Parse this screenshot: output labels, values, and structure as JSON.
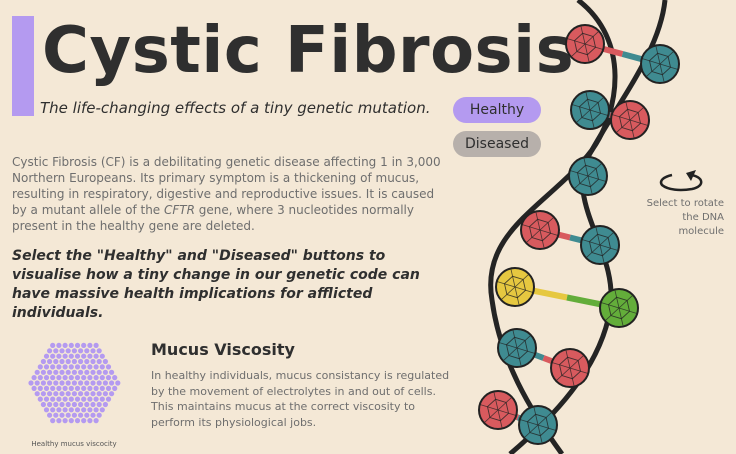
{
  "header": {
    "title": "Cystic Fibrosis",
    "subtitle": "The life-changing effects of a tiny genetic mutation."
  },
  "intro": {
    "text_before": "Cystic Fibrosis (CF) is a debilitating genetic disease affecting 1 in 3,000 Northern Europeans. Its primary symptom is a thickening of mucus, resulting in respiratory, digestive and reproductive issues. It is caused by a mutant allele of the ",
    "gene": "CFTR",
    "text_after": " gene, where 3 nucleotides normally present in the healthy gene are deleted."
  },
  "callout": "Select the \"Healthy\" and \"Diseased\" buttons to visualise how a tiny change in our genetic code can have massive health implications for afflicted individuals.",
  "buttons": {
    "healthy": "Healthy",
    "diseased": "Diseased"
  },
  "rotate_hint": {
    "text": "Select to rotate the DNA molecule",
    "icon": "rotate-arrow-icon"
  },
  "mucus": {
    "title": "Mucus Viscosity",
    "description": "In healthy individuals, mucus consistancy is regulated by the movement of electrolytes in and out of cells. This maintains mucus at the correct viscosity to perform its physiological jobs.",
    "caption": "Healthy mucus viscocity",
    "icon": "mucus-dots-icon"
  },
  "colors": {
    "accent": "#b49af0",
    "diseased_button": "#b7b0ab",
    "background": "#f4e8d6",
    "nucleotide_red": "#d85a5e",
    "nucleotide_teal": "#3f8b91",
    "nucleotide_yellow": "#e6c840",
    "nucleotide_green": "#63ad3a",
    "mucus": "#b49af0"
  },
  "dna": {
    "icon": "dna-helix-icon",
    "base_pairs": [
      [
        "red",
        "teal"
      ],
      [
        "teal",
        "red"
      ],
      [
        "teal",
        "teal"
      ],
      [
        "red",
        "teal"
      ],
      [
        "yellow",
        "green"
      ],
      [
        "teal",
        "red"
      ],
      [
        "red",
        "teal"
      ]
    ]
  }
}
